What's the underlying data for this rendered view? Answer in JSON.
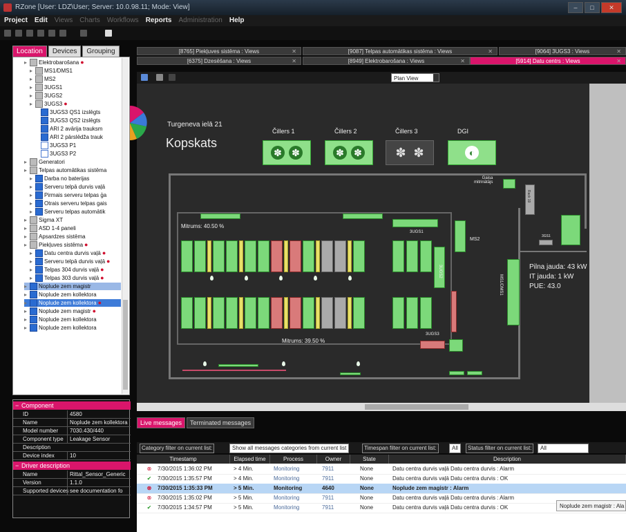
{
  "window": {
    "title": "RZone [User: LDZ\\User; Server: 10.0.98.11; Mode: View]"
  },
  "menu": [
    {
      "label": "Project",
      "dim": false
    },
    {
      "label": "Edit",
      "dim": false
    },
    {
      "label": "Views",
      "dim": true
    },
    {
      "label": "Charts",
      "dim": true
    },
    {
      "label": "Workflows",
      "dim": true
    },
    {
      "label": "Reports",
      "dim": false
    },
    {
      "label": "Administration",
      "dim": true
    },
    {
      "label": "Help",
      "dim": false
    }
  ],
  "left_tabs": [
    "Location",
    "Devices",
    "Grouping"
  ],
  "tree": [
    {
      "label": "Elektrobarošana",
      "indent": 2,
      "icon": "gray",
      "dot": true
    },
    {
      "label": "MS1/DMS1",
      "indent": 3,
      "icon": "gray"
    },
    {
      "label": "MS2",
      "indent": 3,
      "icon": "gray"
    },
    {
      "label": "3UGS1",
      "indent": 3,
      "icon": "gray"
    },
    {
      "label": "3UGS2",
      "indent": 3,
      "icon": "gray"
    },
    {
      "label": "3UGS3",
      "indent": 3,
      "icon": "gray",
      "dot": true
    },
    {
      "label": "3UGS3 QS1 izslēgts",
      "indent": 4,
      "icon": "blue"
    },
    {
      "label": "3UGS3 QS2 izslēgts",
      "indent": 4,
      "icon": "blue"
    },
    {
      "label": "ARI 2 avārija trauksm",
      "indent": 4,
      "icon": "blue"
    },
    {
      "label": "ARI 2 pārslēdža trauk",
      "indent": 4,
      "icon": "blue"
    },
    {
      "label": "3UGS3 P1",
      "indent": 4,
      "icon": "c"
    },
    {
      "label": "3UGS3 P2",
      "indent": 4,
      "icon": "c"
    },
    {
      "label": "Generatori",
      "indent": 2,
      "icon": "gray"
    },
    {
      "label": "Telpas automātikas sistēma",
      "indent": 2,
      "icon": "gray"
    },
    {
      "label": "Darba no baterijas",
      "indent": 3,
      "icon": "blue"
    },
    {
      "label": "Serveru telpā durvis vaļā",
      "indent": 3,
      "icon": "blue"
    },
    {
      "label": "Pirmais serveru telpas ģa",
      "indent": 3,
      "icon": "blue"
    },
    {
      "label": "Otrais serveru telpas gais",
      "indent": 3,
      "icon": "blue"
    },
    {
      "label": "Serveru telpas automātik",
      "indent": 3,
      "icon": "blue"
    },
    {
      "label": "Sigma XT",
      "indent": 2,
      "icon": "gray"
    },
    {
      "label": "ASD 1-4 paneli",
      "indent": 2,
      "icon": "gray"
    },
    {
      "label": "Apsardzes sistēma",
      "indent": 2,
      "icon": "gray"
    },
    {
      "label": "Piekļuves sistēma",
      "indent": 2,
      "icon": "gray",
      "dot": true
    },
    {
      "label": "Datu centra durvis vaļā",
      "indent": 3,
      "icon": "blue",
      "dot": true
    },
    {
      "label": "Serveru telpā durvis vaļā",
      "indent": 3,
      "icon": "blue",
      "dot": true
    },
    {
      "label": "Telpas 304 durvis vaļā",
      "indent": 3,
      "icon": "blue",
      "dot": true
    },
    {
      "label": "Telpas 303 durvis vaļā",
      "indent": 3,
      "icon": "blue",
      "dot": true
    },
    {
      "label": "Noplude zem magistr",
      "indent": 2,
      "icon": "blue",
      "sel": "light"
    },
    {
      "label": "Noplude zem kollektora",
      "indent": 2,
      "icon": "blue"
    },
    {
      "label": "Noplude zem kollektora",
      "indent": 2,
      "icon": "blue",
      "dot": true,
      "sel": "dark"
    },
    {
      "label": "Noplude zem magistr",
      "indent": 2,
      "icon": "blue",
      "dot": true
    },
    {
      "label": "Noplude zem kollektora",
      "indent": 2,
      "icon": "blue"
    },
    {
      "label": "Noplude zem kollektora",
      "indent": 2,
      "icon": "blue"
    }
  ],
  "props": {
    "component_header": "Component",
    "component": [
      {
        "k": "ID",
        "v": "4580"
      },
      {
        "k": "Name",
        "v": "Noplude zem kollektora"
      },
      {
        "k": "Model number",
        "v": "7030.430/440"
      },
      {
        "k": "Component type",
        "v": "Leakage Sensor"
      },
      {
        "k": "Description",
        "v": ""
      },
      {
        "k": "Device index",
        "v": "10"
      }
    ],
    "driver_header": "Driver description",
    "driver": [
      {
        "k": "Name",
        "v": "Rittal_Sensor_Generic"
      },
      {
        "k": "Version",
        "v": "1.1.0"
      },
      {
        "k": "Supported devices",
        "v": "see documentation fo"
      }
    ]
  },
  "doc_tabs_row1": [
    {
      "label": "[8765] Piekļuves sistēma : Views"
    },
    {
      "label": "[9087] Telpas automātikas sistēma : Views"
    },
    {
      "label": "[9064] 3UGS3 : Views"
    }
  ],
  "doc_tabs_row2": [
    {
      "label": "[6375] Dzesēšana : Views",
      "active": false
    },
    {
      "label": "[8949] Elektrobarošana : Views",
      "active": false
    },
    {
      "label": "[5914] Datu centrs : Views",
      "active": true
    }
  ],
  "view_selector": "Plan View",
  "plan": {
    "address": "Turgeneva ielā 21",
    "title": "Kopskats",
    "chillers": [
      {
        "label": "Čillers 1",
        "on": true
      },
      {
        "label": "Čillers 2",
        "on": true
      },
      {
        "label": "Čillers 3",
        "on": false
      },
      {
        "label": "DGI",
        "on": true
      }
    ],
    "humidity_top": "Mitrums: 40.50 %",
    "humidity_bottom": "Mitrums: 39.50 %",
    "gas_label": "Gaisa\nmitrinātājs",
    "ms2": "MS2",
    "ugs1": "3UGS1",
    "ugs2": "3UGS2",
    "ugs3": "3UGS3",
    "msdms1": "MS1/DMS1",
    "rack_label": "Rack 19",
    "sgs1": "3GS1",
    "full_load": "Pilna jauda: 43 kW",
    "it_load": "IT jauda: 1 kW",
    "pue": "PUE: 43.0",
    "colors": {
      "green": "#7cd97a",
      "red": "#d97a7a",
      "gray": "#aaaaaa",
      "yellow": "#e8e06a",
      "accent": "#d9156b"
    }
  },
  "message_tabs": [
    "Live messages",
    "Terminated messages"
  ],
  "filters": {
    "category_label": "Category filter on current list:",
    "category_value": "Show all messages categories from current list",
    "timespan_label": "Timespan filter on current list:",
    "timespan_value": "All",
    "status_label": "Status filter on current list:",
    "status_value": "All"
  },
  "messages": {
    "columns": [
      "Timestamp",
      "Elapsed time",
      "Process",
      "Owner",
      "State",
      "Description"
    ],
    "rows": [
      {
        "icon": "error",
        "ts": "7/30/2015 1:36:02 PM",
        "el": "> 4 Min.",
        "proc": "Monitoring",
        "owner": "7911",
        "state": "None",
        "desc": "Datu centra durvis vaļā Datu centra durvis : Alarm",
        "sel": false
      },
      {
        "icon": "ok",
        "ts": "7/30/2015 1:35:57 PM",
        "el": "> 4 Min.",
        "proc": "Monitoring",
        "owner": "7911",
        "state": "None",
        "desc": "Datu centra durvis vaļā Datu centra durvis : OK",
        "sel": false
      },
      {
        "icon": "error",
        "ts": "7/30/2015 1:35:33 PM",
        "el": "> 5 Min.",
        "proc": "Monitoring",
        "owner": "4640",
        "state": "None",
        "desc": "Noplude zem magistr : Alarm",
        "sel": true
      },
      {
        "icon": "error",
        "ts": "7/30/2015 1:35:02 PM",
        "el": "> 5 Min.",
        "proc": "Monitoring",
        "owner": "7911",
        "state": "None",
        "desc": "Datu centra durvis vaļā Datu centra durvis : Alarm",
        "sel": false
      },
      {
        "icon": "ok",
        "ts": "7/30/2015 1:34:57 PM",
        "el": "> 5 Min.",
        "proc": "Monitoring",
        "owner": "7911",
        "state": "None",
        "desc": "Datu centra durvis vaļā Datu centra durvis : OK",
        "sel": false
      }
    ]
  },
  "tooltip": "Noplude zem magistr : Ala"
}
